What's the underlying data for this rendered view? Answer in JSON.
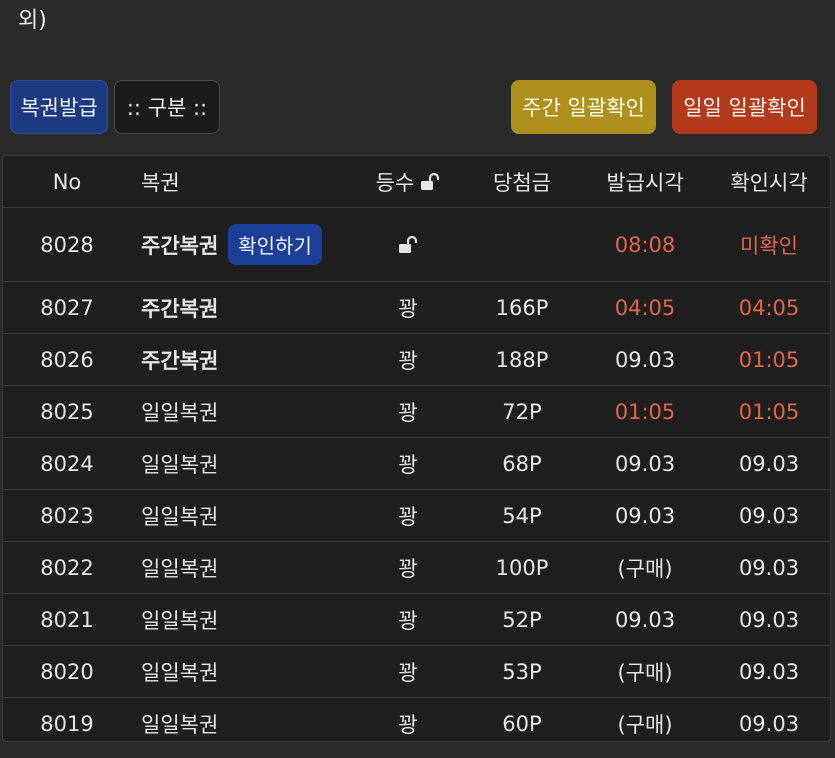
{
  "top_text": "외)",
  "toolbar": {
    "issue_label": "복권발급",
    "filter_label": ":: 구분 ::",
    "weekly_confirm_label": "주간 일괄확인",
    "daily_confirm_label": "일일 일괄확인"
  },
  "table": {
    "headers": {
      "no": "No",
      "name": "복권",
      "grade": "등수",
      "prize": "당첨금",
      "issued": "발급시각",
      "checked": "확인시각"
    },
    "confirm_button_label": "확인하기",
    "rows": [
      {
        "no": "8028",
        "name": "주간복권",
        "grade": "",
        "prize": "",
        "issued": "08:08",
        "checked": "미확인"
      },
      {
        "no": "8027",
        "name": "주간복권",
        "grade": "꽝",
        "prize": "166P",
        "issued": "04:05",
        "checked": "04:05"
      },
      {
        "no": "8026",
        "name": "주간복권",
        "grade": "꽝",
        "prize": "188P",
        "issued": "09.03",
        "checked": "01:05"
      },
      {
        "no": "8025",
        "name": "일일복권",
        "grade": "꽝",
        "prize": "72P",
        "issued": "01:05",
        "checked": "01:05"
      },
      {
        "no": "8024",
        "name": "일일복권",
        "grade": "꽝",
        "prize": "68P",
        "issued": "09.03",
        "checked": "09.03"
      },
      {
        "no": "8023",
        "name": "일일복권",
        "grade": "꽝",
        "prize": "54P",
        "issued": "09.03",
        "checked": "09.03"
      },
      {
        "no": "8022",
        "name": "일일복권",
        "grade": "꽝",
        "prize": "100P",
        "issued": "(구매)",
        "checked": "09.03"
      },
      {
        "no": "8021",
        "name": "일일복권",
        "grade": "꽝",
        "prize": "52P",
        "issued": "09.03",
        "checked": "09.03"
      },
      {
        "no": "8020",
        "name": "일일복권",
        "grade": "꽝",
        "prize": "53P",
        "issued": "(구매)",
        "checked": "09.03"
      },
      {
        "no": "8019",
        "name": "일일복권",
        "grade": "꽝",
        "prize": "60P",
        "issued": "(구매)",
        "checked": "09.03"
      }
    ]
  },
  "colors": {
    "background": "#2a2a2a",
    "issue_button": "#1c3a80",
    "weekly_button": "#b0901c",
    "daily_button": "#b23a1c",
    "highlight_text": "#e0654a"
  }
}
